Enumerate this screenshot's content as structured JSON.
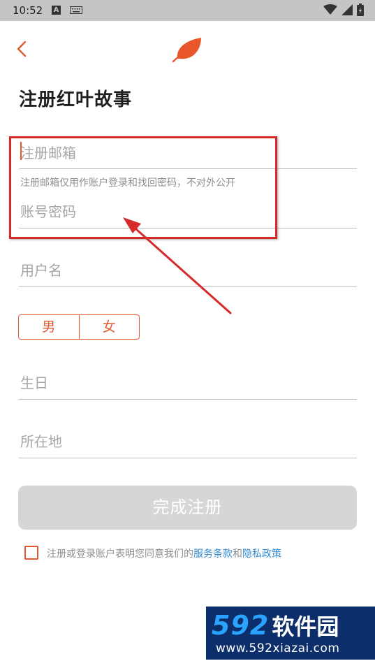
{
  "statusbar": {
    "time": "10:52",
    "a_icon": "A"
  },
  "header": {
    "back_icon": "chevron-left-icon",
    "logo_icon": "leaf-icon"
  },
  "title": "注册红叶故事",
  "form": {
    "email_placeholder": "注册邮箱",
    "email_hint": "注册邮箱仅用作账户登录和找回密码，不对外公开",
    "password_placeholder": "账号密码",
    "username_placeholder": "用户名",
    "gender_male": "男",
    "gender_female": "女",
    "birthday_placeholder": "生日",
    "location_placeholder": "所在地",
    "submit_label": "完成注册"
  },
  "agreement": {
    "prefix": "注册或登录账户表明您同意我们的",
    "terms_link": "服务条款",
    "and": "和",
    "privacy_link": "隐私政策"
  },
  "watermark": {
    "number": "592",
    "brand": "软件园",
    "url": "www.592xiazai.com"
  },
  "colors": {
    "accent": "#e2582e",
    "link": "#2f8ad2",
    "annotation": "#d62a2a",
    "button_disabled": "#d6d6d6"
  }
}
